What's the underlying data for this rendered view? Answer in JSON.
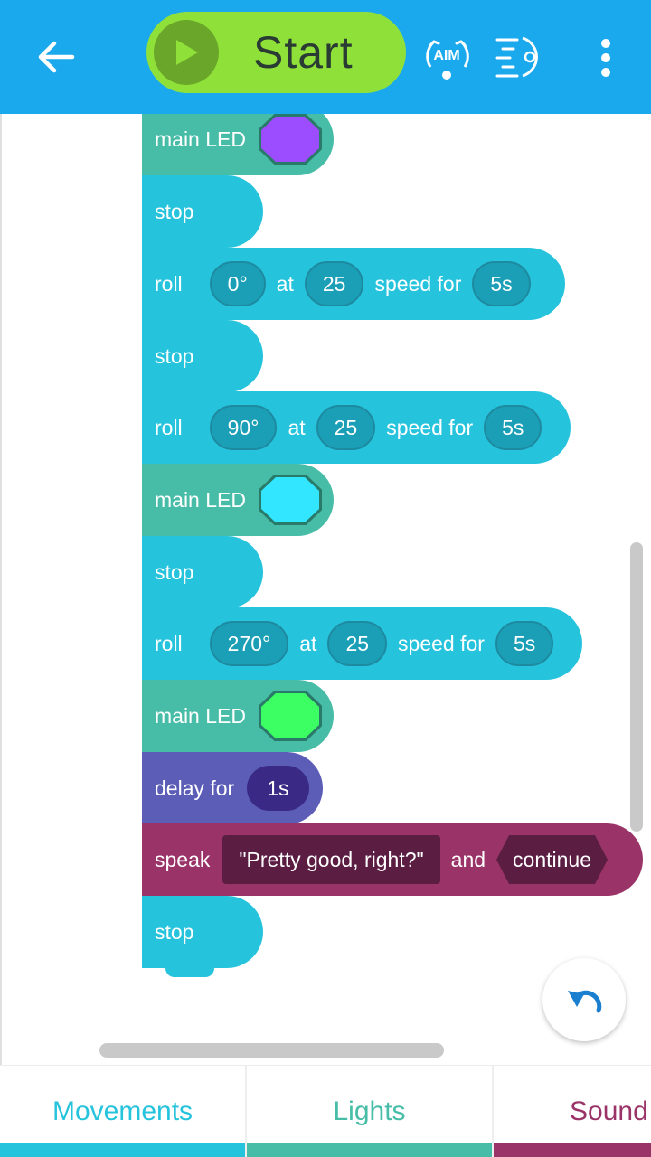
{
  "header": {
    "start_label": "Start",
    "aim_label": "AIM",
    "colors": {
      "bar": "#1ba9ee",
      "start": "#8fe13a",
      "start_icon": "#69a62a"
    }
  },
  "blocks": [
    {
      "type": "led",
      "label": "main LED",
      "color": "#9b4dff"
    },
    {
      "type": "stop",
      "label": "stop"
    },
    {
      "type": "roll",
      "label": "roll",
      "heading": "0°",
      "at": "at",
      "speed": "25",
      "speed_for": "speed for",
      "duration": "5s"
    },
    {
      "type": "stop",
      "label": "stop"
    },
    {
      "type": "roll",
      "label": "roll",
      "heading": "90°",
      "at": "at",
      "speed": "25",
      "speed_for": "speed for",
      "duration": "5s"
    },
    {
      "type": "led",
      "label": "main LED",
      "color": "#33e6ff"
    },
    {
      "type": "stop",
      "label": "stop"
    },
    {
      "type": "roll",
      "label": "roll",
      "heading": "270°",
      "at": "at",
      "speed": "25",
      "speed_for": "speed for",
      "duration": "5s"
    },
    {
      "type": "led",
      "label": "main LED",
      "color": "#3cff64"
    },
    {
      "type": "delay",
      "label": "delay for",
      "duration": "1s"
    },
    {
      "type": "speak",
      "label": "speak",
      "text": "\"Pretty good, right?\"",
      "and": "and",
      "mode": "continue"
    },
    {
      "type": "stop",
      "label": "stop"
    }
  ],
  "tabs": [
    {
      "label": "Movements",
      "color": "#26c3dd"
    },
    {
      "label": "Lights",
      "color": "#47bca7"
    },
    {
      "label": "Sound",
      "color": "#9a3468"
    }
  ]
}
